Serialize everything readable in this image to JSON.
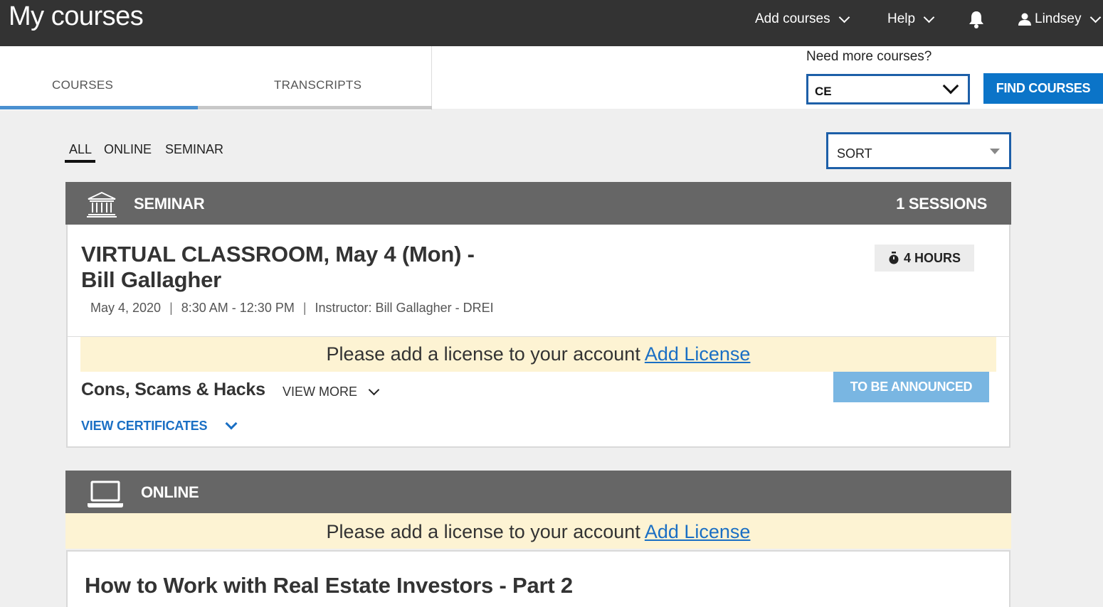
{
  "topbar": {
    "title": "My courses",
    "add_courses": "Add courses",
    "help": "Help",
    "user": "Lindsey"
  },
  "tabs": [
    {
      "label": "COURSES",
      "active": true
    },
    {
      "label": "TRANSCRIPTS",
      "active": false
    }
  ],
  "find": {
    "prompt": "Need more courses?",
    "selected": "CE",
    "button": "FIND COURSES"
  },
  "filters": [
    {
      "label": "ALL",
      "active": true
    },
    {
      "label": "ONLINE",
      "active": false
    },
    {
      "label": "SEMINAR",
      "active": false
    }
  ],
  "sort": {
    "label": "SORT"
  },
  "seminar": {
    "header": "SEMINAR",
    "sessions": "1 SESSIONS",
    "course": {
      "title": "VIRTUAL CLASSROOM, May 4 (Mon) - Bill Gallagher",
      "date": "May 4, 2020",
      "time": "8:30 AM - 12:30 PM",
      "instructor": "Instructor: Bill Gallagher - DREI",
      "hours": "4 HOURS",
      "license_text": "Please add a license to your account",
      "license_link": "Add License",
      "subject": "Cons, Scams & Hacks",
      "view_more": "VIEW MORE",
      "status_button": "TO BE ANNOUNCED",
      "view_certificates": "VIEW CERTIFICATES"
    }
  },
  "online": {
    "header": "ONLINE",
    "license_text": "Please add a license to your account",
    "license_link": "Add License",
    "course_title": "How to Work with Real Estate Investors - Part 2"
  },
  "colors": {
    "topbar": "#333333",
    "accent_blue": "#0b74c8",
    "section_header": "#666666",
    "license_bg": "#fdf3d3",
    "tba_button": "#79b6e2"
  },
  "icons": [
    "chevron-down-icon",
    "bell-icon",
    "user-icon",
    "building-icon",
    "stopwatch-icon",
    "laptop-icon"
  ]
}
